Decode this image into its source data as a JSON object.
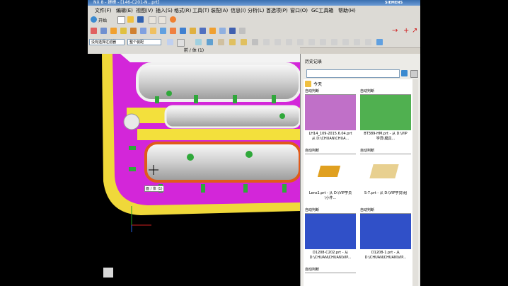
{
  "window": {
    "title": "NX 8 - 建模 - [146-C201-N...prt]",
    "brand": "SIEMENS"
  },
  "menu": [
    {
      "label": "文件(F)"
    },
    {
      "label": "编辑(E)"
    },
    {
      "label": "视图(V)"
    },
    {
      "label": "插入(S)"
    },
    {
      "label": "格式(R)"
    },
    {
      "label": "工具(T)"
    },
    {
      "label": "装配(A)"
    },
    {
      "label": "信息(I)"
    },
    {
      "label": "分析(L)"
    },
    {
      "label": "首选项(P)"
    },
    {
      "label": "窗口(O)"
    },
    {
      "label": "GC工具箱"
    },
    {
      "label": "帮助(H)"
    }
  ],
  "toolbar": {
    "start_label": "开始",
    "selection_filter": "没有选择过滤器",
    "scope": "整个装配"
  },
  "viewport": {
    "title": "前 / 体 (1)",
    "cursor_tag": "面 / 体 (1)"
  },
  "history": {
    "title": "历史记录",
    "group": "今天",
    "items": [
      {
        "label": "自动判断",
        "caption_1": "LH14_109-2015.6.04.prt",
        "caption_2": "从 D:\\CHUAN\\CHUA...",
        "color": "#c070c8"
      },
      {
        "label": "自动判断",
        "caption_1": "BT389-HM.prt - 从 D:\\VIP",
        "caption_2": "学员\\模具...",
        "color": "#50b050"
      },
      {
        "label": "自动判断",
        "caption_1": "Lens1.prt - 从 D:\\VIP学员",
        "caption_2": "\\小件...",
        "color": "#e0a020"
      },
      {
        "label": "自动判断",
        "caption_1": "S-7.prt - 从 D:\\VIP学员\\组",
        "caption_2": "",
        "color": "#e8d090"
      },
      {
        "label": "自动判断",
        "caption_1": "D1208-C202.prt - 从",
        "caption_2": "D:\\CHUAN\\CHUAN\\VIP...",
        "color": "#3050c8"
      },
      {
        "label": "自动判断",
        "caption_1": "D1208-1.prt - 从",
        "caption_2": "D:\\CHUAN\\CHUAN\\VIP...",
        "color": "#3050c8"
      },
      {
        "label": "自动判断",
        "caption_1": "",
        "caption_2": "",
        "color": "#ffffff"
      }
    ]
  }
}
